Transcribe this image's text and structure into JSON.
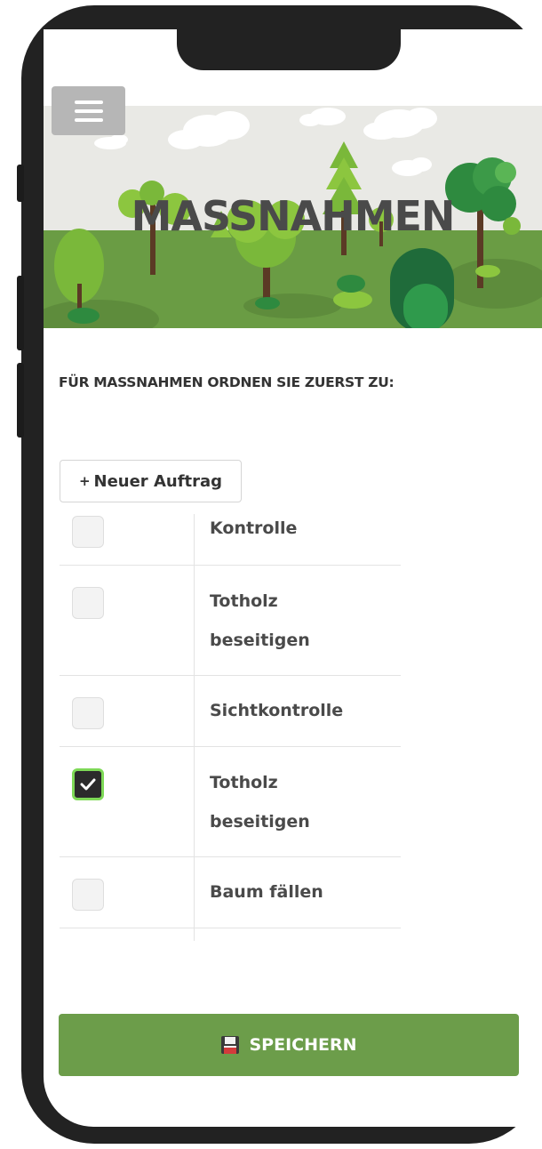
{
  "header": {
    "menu_icon": "hamburger-menu-icon",
    "title": "MASSNAHMEN"
  },
  "section": {
    "heading": "FÜR MASSNAHMEN ORDNEN SIE ZUERST ZU:"
  },
  "new_order_button": {
    "plus": "+",
    "label": "Neuer Auftrag"
  },
  "measures": [
    {
      "label_line1": "Kontrolle",
      "label_line2": "",
      "checked": false
    },
    {
      "label_line1": "Totholz",
      "label_line2": "beseitigen",
      "checked": false
    },
    {
      "label_line1": "Sichtkontrolle",
      "label_line2": "",
      "checked": false
    },
    {
      "label_line1": "Totholz",
      "label_line2": "beseitigen",
      "checked": true
    },
    {
      "label_line1": "Baum fällen",
      "label_line2": "",
      "checked": false
    }
  ],
  "save_button": {
    "icon": "floppy-disk-icon",
    "label": "SPEICHERN"
  },
  "colors": {
    "accent_green": "#6c9d4a",
    "checkbox_checked_border": "#7ed957",
    "frame": "#222222"
  }
}
